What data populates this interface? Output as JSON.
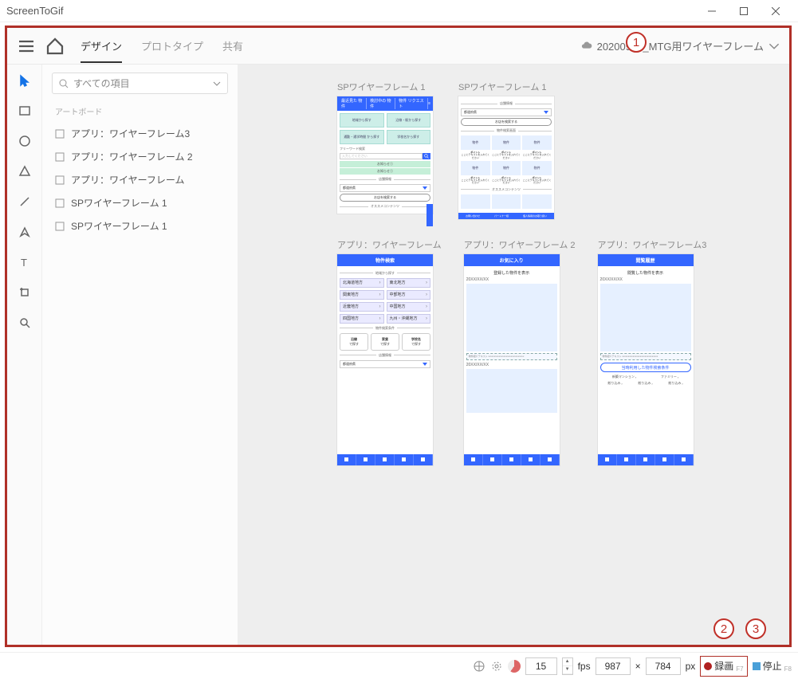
{
  "window": {
    "title": "ScreenToGif"
  },
  "nav": {
    "tabs": {
      "design": "デザイン",
      "prototype": "プロトタイプ",
      "share": "共有"
    },
    "filename": "20200917_MTG用ワイヤーフレーム"
  },
  "search": {
    "placeholder": "すべての項目"
  },
  "artboard_section": "アートボード",
  "artboards": [
    "アプリ：ワイヤーフレーム3",
    "アプリ：ワイヤーフレーム 2",
    "アプリ：ワイヤーフレーム",
    "SPワイヤーフレーム 1",
    "SPワイヤーフレーム 1"
  ],
  "canvas_labels": {
    "sp1a": "SPワイヤーフレーム 1",
    "sp1b": "SPワイヤーフレーム 1",
    "app1": "アプリ：ワイヤーフレーム",
    "app2": "アプリ：ワイヤーフレーム 2",
    "app3": "アプリ：ワイヤーフレーム3"
  },
  "sp1a": {
    "hdr_cells": [
      "最近見た\\n物件",
      "検討中の\\n物件",
      "物件\\nリクエスト"
    ],
    "grid": [
      "地域から探す",
      "沿線・駅から探す",
      "通勤・通学時間\\nから探す",
      "学校名から探す"
    ],
    "freeword": "フリーワード検索",
    "search_ph": "入力してください",
    "notices": [
      "お知らせ①",
      "お知らせ①"
    ],
    "store_hdr": "店舗情報",
    "dd": "都道府県",
    "obtn": "お店を検索する",
    "reco": "オススメコンテンツ"
  },
  "sp1b": {
    "store_hdr": "店舗情報",
    "dd": "都道府県",
    "obtn": "お店を検索する",
    "search_hdr": "物件検索画面",
    "cell": "物件",
    "point": "ポイント",
    "point_sub": "ここにテキストを入れてください",
    "reco": "オススメコンテンツ",
    "foot": [
      "お問い合わせ",
      "パートナー様",
      "個人情報のお取り扱い"
    ]
  },
  "app1": {
    "hdr": "物件検索",
    "sec1": "地域から探す",
    "regions": [
      "北海道地方",
      "東北地方",
      "関東地方",
      "中部地方",
      "近畿地方",
      "中国地方",
      "四国地方",
      "九州・沖縄地方"
    ],
    "cond_hdr": "物件検索条件",
    "conds": [
      [
        "沿線",
        "で探す"
      ],
      [
        "家賃",
        "で探す"
      ],
      [
        "学校名",
        "で探す"
      ]
    ],
    "store_hdr": "店舗情報",
    "dd": "都道府県"
  },
  "app2": {
    "hdr": "お気に入り",
    "sub": "登録した物件を表示",
    "date": "20XX/XX/XX",
    "desc": "物件紹介テキスト\\nxxxxxxxxxxxxxxxxxxxxxxxxxxxxxx"
  },
  "app3": {
    "hdr": "閲覧履歴",
    "sub": "閲覧した物件を表示",
    "date": "20XX/XX/XX",
    "desc": "物件紹介テキスト\\nxxxxxxxxxxxxxxxxxxxxxxxxxxxxxx",
    "btn": "当時利用した物件検索条件",
    "filters": [
      "新築マンション",
      "ファミリー"
    ],
    "class": "絞り込み"
  },
  "status": {
    "fps_val": "15",
    "fps_lbl": "fps",
    "w": "987",
    "h": "784",
    "px": "px",
    "rec": "録画",
    "rec_key": "F7",
    "stop": "停止",
    "stop_key": "F8",
    "x": "×"
  },
  "annotations": {
    "a1": "1",
    "a2": "2",
    "a3": "3"
  }
}
